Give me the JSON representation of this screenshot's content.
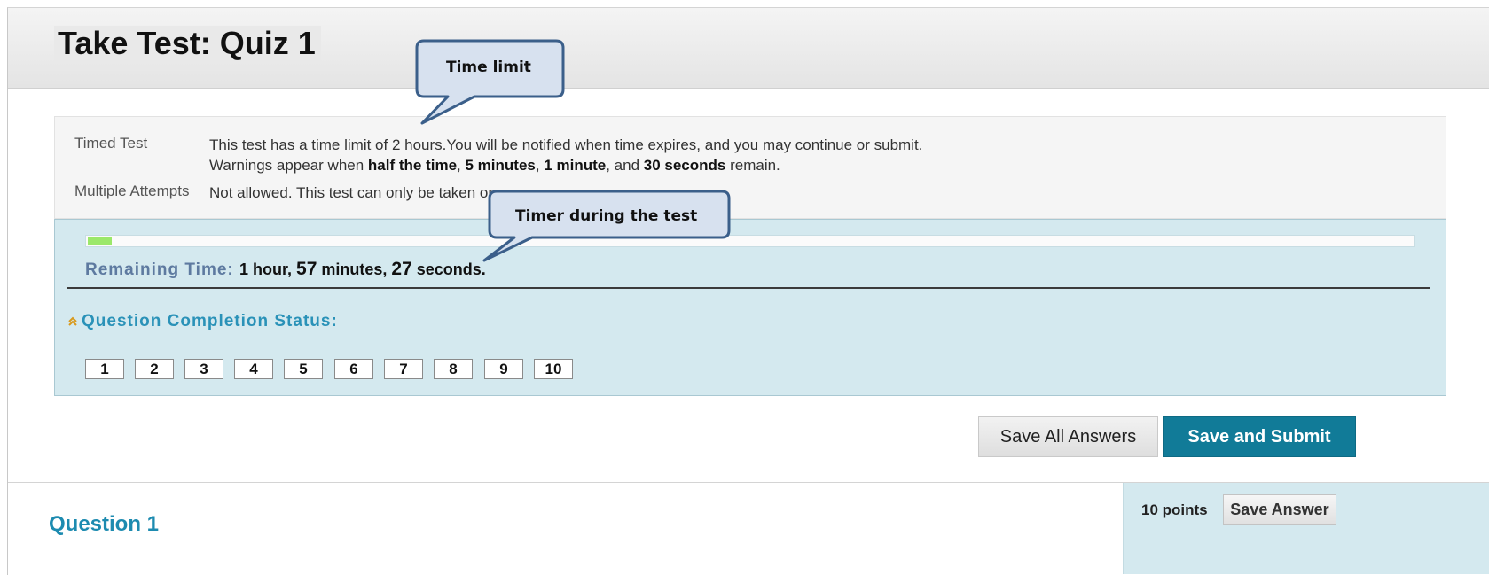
{
  "page": {
    "title": "Take Test: Quiz 1"
  },
  "info": {
    "timed_label": "Timed Test",
    "timed_line1": "This test has a time limit of 2 hours.You will be notified when time expires, and you may continue or submit.",
    "timed_line2_prefix": "Warnings appear when ",
    "warn_half": "half the time",
    "sep1": ", ",
    "warn_5min": "5 minutes",
    "sep2": ", ",
    "warn_1min": "1 minute",
    "sep3": ", and ",
    "warn_30sec": "30 seconds",
    "timed_line2_suffix": " remain.",
    "attempts_label": "Multiple Attempts",
    "attempts_text": "Not allowed. This test can only be taken once."
  },
  "timer": {
    "progress_fraction": 0.018,
    "progress_color": "#9be86a",
    "remaining_label": "Remaining Time: ",
    "hours_text": "1 hour, ",
    "minutes_value": "57",
    "minutes_text": " minutes, ",
    "seconds_value": "27",
    "seconds_text": " seconds."
  },
  "completion": {
    "icon": "double-chevron-up-icon",
    "label": "Question Completion Status:",
    "questions": [
      "1",
      "2",
      "3",
      "4",
      "5",
      "6",
      "7",
      "8",
      "9",
      "10"
    ]
  },
  "actions": {
    "save_all_label": "Save All Answers",
    "submit_label": "Save and Submit",
    "submit_color": "#117b98"
  },
  "question": {
    "title": "Question 1",
    "points": "10 points",
    "save_answer_label": "Save Answer"
  },
  "callouts": {
    "time_limit": "Time limit",
    "timer_during_test": "Timer during the test"
  }
}
